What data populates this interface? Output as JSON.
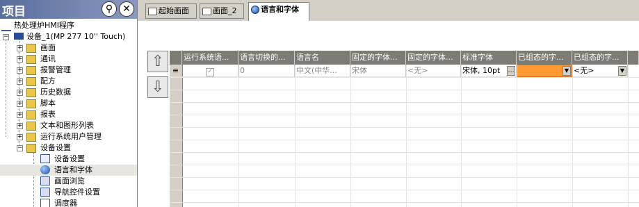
{
  "project_pane": {
    "title": "项目",
    "pin_icon": "pin-icon",
    "close_icon": "close-icon",
    "root": "热处理炉HMI程序",
    "device": "设备_1(MP 277 10'' Touch)",
    "items": [
      {
        "label": "画面",
        "icon": "folder-icon"
      },
      {
        "label": "通讯",
        "icon": "folder-icon"
      },
      {
        "label": "报警管理",
        "icon": "folder-icon"
      },
      {
        "label": "配方",
        "icon": "folder-icon"
      },
      {
        "label": "历史数据",
        "icon": "folder-icon"
      },
      {
        "label": "脚本",
        "icon": "folder-icon"
      },
      {
        "label": "报表",
        "icon": "folder-icon"
      },
      {
        "label": "文本和图形列表",
        "icon": "folder-icon"
      },
      {
        "label": "运行系统用户管理",
        "icon": "folder-icon"
      },
      {
        "label": "设备设置",
        "icon": "folder-icon"
      }
    ],
    "sub_items": [
      {
        "label": "设备设置",
        "icon": "device-settings-icon"
      },
      {
        "label": "语言和字体",
        "icon": "globe-icon"
      },
      {
        "label": "画面浏览",
        "icon": "screen-nav-icon"
      },
      {
        "label": "导航控件设置",
        "icon": "nav-control-icon"
      },
      {
        "label": "调度器",
        "icon": "scheduler-icon"
      }
    ]
  },
  "tabs": [
    {
      "label": "起始画面",
      "active": false
    },
    {
      "label": "画面_2",
      "active": false
    },
    {
      "label": "语言和字体",
      "active": true
    }
  ],
  "grid": {
    "columns": [
      "运行系统语...",
      "语言切换的...",
      "语言名",
      "固定的字体...",
      "固定的字体...",
      "标准字体",
      "已组态的字...",
      "已组态的字..."
    ],
    "row": {
      "checked": true,
      "switch_order": "0",
      "language_name": "中文(中华...",
      "fixed_font_1": "宋体",
      "fixed_font_2": "<无>",
      "standard_font": "宋体, 10pt",
      "configured_font_1": "",
      "configured_font_2": "<无>"
    }
  },
  "colors": {
    "accent_orange": "#ff9933",
    "header_gray": "#7d7b76"
  }
}
